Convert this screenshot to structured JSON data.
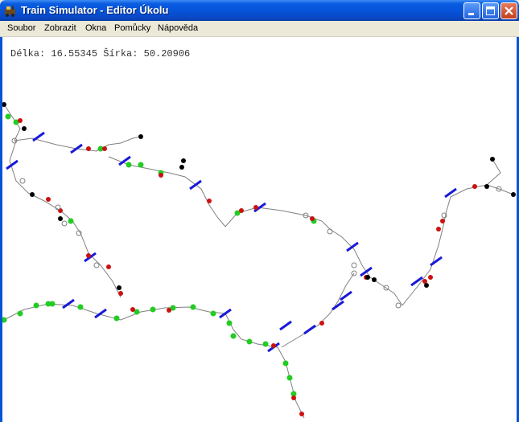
{
  "window": {
    "title": "Train Simulator - Editor Úkolu",
    "app_icon": "train-app-icon",
    "buttons": {
      "minimize": "minimize-icon",
      "maximize": "maximize-icon",
      "close": "close-icon"
    }
  },
  "menubar": {
    "items": [
      "Soubor",
      "Zobrazit",
      "Okna",
      "Pomůcky",
      "Nápověda"
    ]
  },
  "status": {
    "coords_text": "Délka: 16.55345 Šírka: 50.20906"
  },
  "colors": {
    "track": "#808080",
    "signal": "#1a1ad8",
    "green_marker": "#22cc22",
    "red_marker": "#cc1111",
    "black_marker": "#000000",
    "title_blue": "#0553d8"
  }
}
